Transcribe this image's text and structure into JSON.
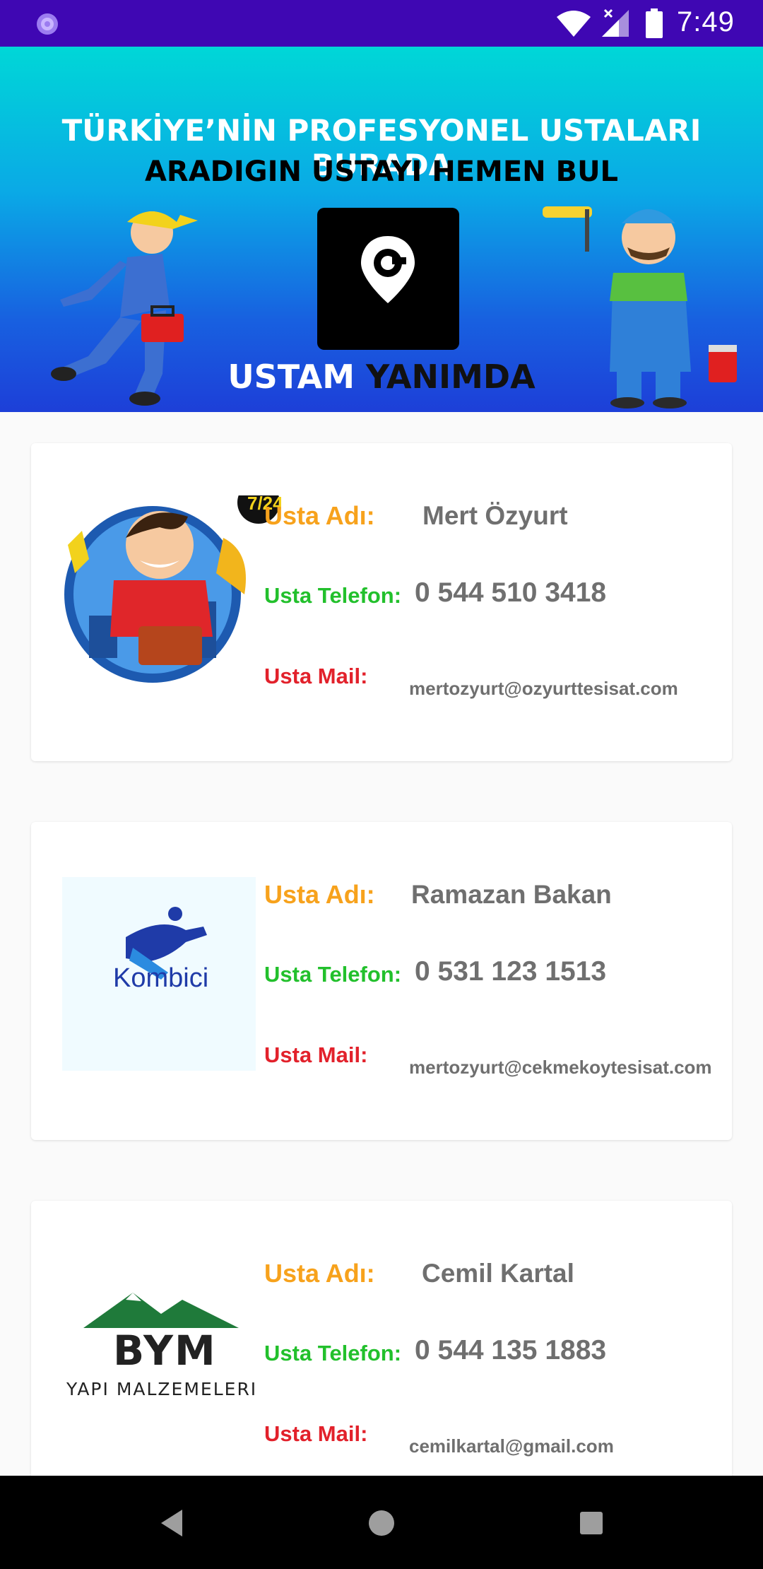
{
  "status_bar": {
    "time": "7:49",
    "icons": [
      "app-notification-icon",
      "wifi-icon",
      "signal-icon",
      "battery-icon"
    ]
  },
  "banner": {
    "headline": "TÜRKİYE’NİN PROFESYONEL USTALARI BURADA",
    "subline": "ARADIGIN USTAYI HEMEN BUL",
    "brand_part1": "USTAM",
    "brand_part2": "YANIMDA"
  },
  "labels": {
    "name": "Usta Adı:",
    "phone": "Usta Telefon:",
    "mail": "Usta Mail:"
  },
  "masters": [
    {
      "name": "Mert Özyurt",
      "phone": "0 544 510 3418",
      "mail": "mertozyurt@ozyurttesisat.com",
      "logo": "plumber-cartoon-logo",
      "badge": "7/24"
    },
    {
      "name": "Ramazan Bakan",
      "phone": "0 531 123 1513",
      "mail": "mertozyurt@cekmekoytesisat.com",
      "logo": "kombici-logo",
      "logo_text": "Kombici"
    },
    {
      "name": "Cemil Kartal",
      "phone": "0 544 135 1883",
      "mail": "cemilkartal@gmail.com",
      "logo": "bym-logo",
      "logo_text": "BYM",
      "logo_subtext": "YAPI MALZEMELERI"
    }
  ],
  "nav_bar": {
    "buttons": [
      "back-button",
      "home-button",
      "recents-button"
    ]
  },
  "colors": {
    "status_bar": "#3f07b3",
    "label_name": "#f7a21c",
    "label_phone": "#22c02c",
    "label_mail": "#e2212b",
    "value_text": "#6f6f6f"
  }
}
